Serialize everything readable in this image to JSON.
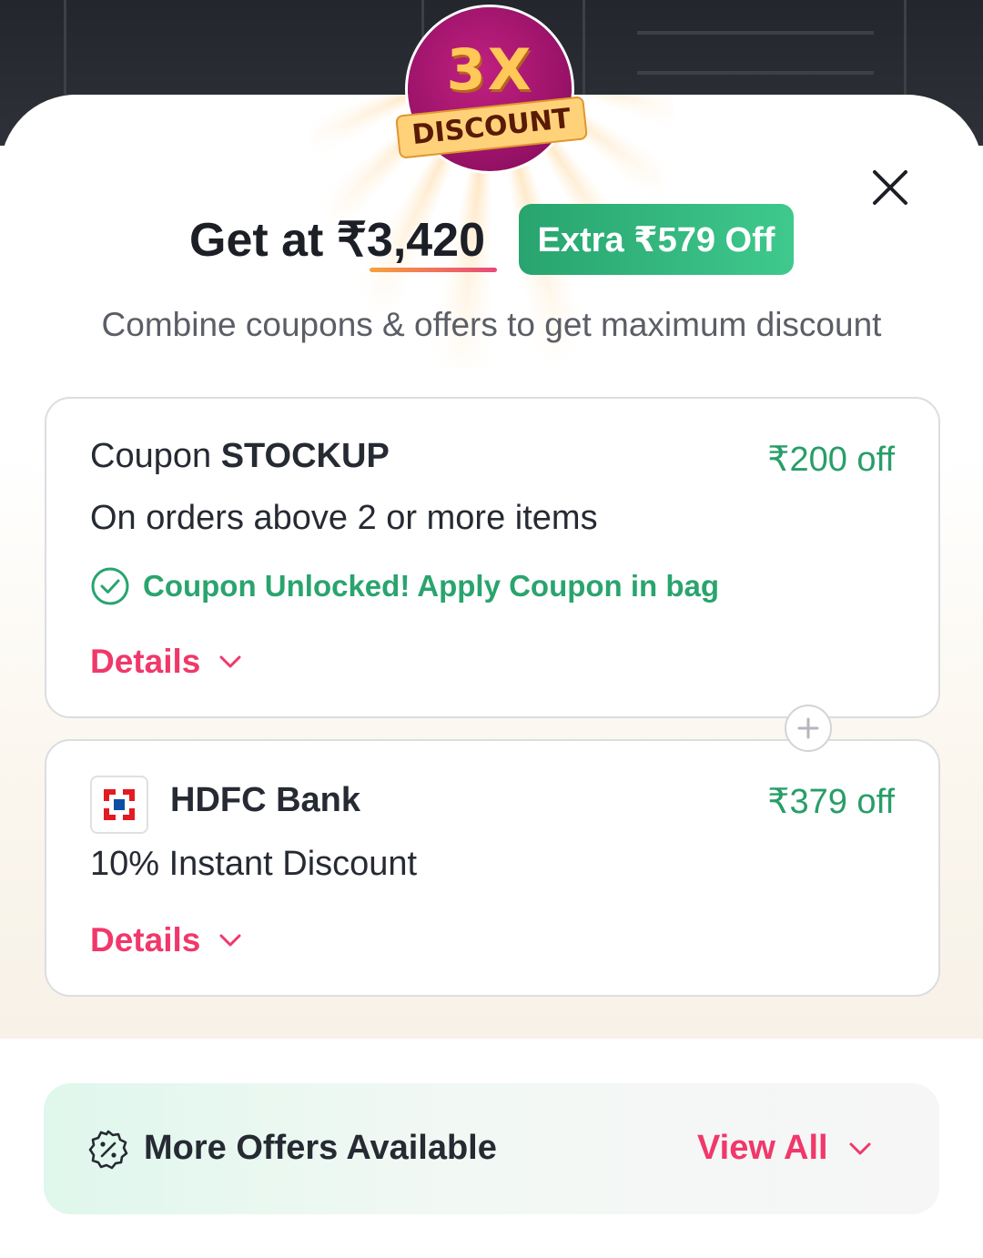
{
  "badge": {
    "multiplier": "3X",
    "label": "DISCOUNT"
  },
  "header": {
    "price_text": "Get at ₹3,420",
    "extra_off": "Extra ₹579 Off",
    "subtitle": "Combine coupons & offers to get maximum discount"
  },
  "coupon_card": {
    "prefix": "Coupon",
    "code": "STOCKUP",
    "discount": "₹200 off",
    "description": "On orders above 2 or more items",
    "status": "Coupon Unlocked! Apply Coupon in bag",
    "details_label": "Details"
  },
  "bank_card": {
    "name": "HDFC Bank",
    "discount": "₹379 off",
    "description": "10% Instant Discount",
    "details_label": "Details"
  },
  "more_offers": {
    "label": "More Offers Available",
    "view_all": "View All"
  },
  "colors": {
    "green": "#279e68",
    "pink": "#f0386b",
    "badge": "#9c136a"
  }
}
